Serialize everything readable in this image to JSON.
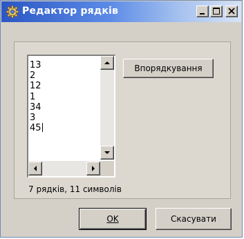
{
  "window": {
    "title": "Редактор рядків",
    "accent_color": "#2b56c4",
    "title_icon": "gear-icon"
  },
  "editor": {
    "lines": [
      "13",
      "2",
      "12",
      "1",
      "34",
      "3",
      "45"
    ]
  },
  "buttons": {
    "sort_label": "Впорядкування",
    "ok_label": "ОK",
    "cancel_label": "Скасувати"
  },
  "status": {
    "text": "7 рядків, 11 символів"
  }
}
